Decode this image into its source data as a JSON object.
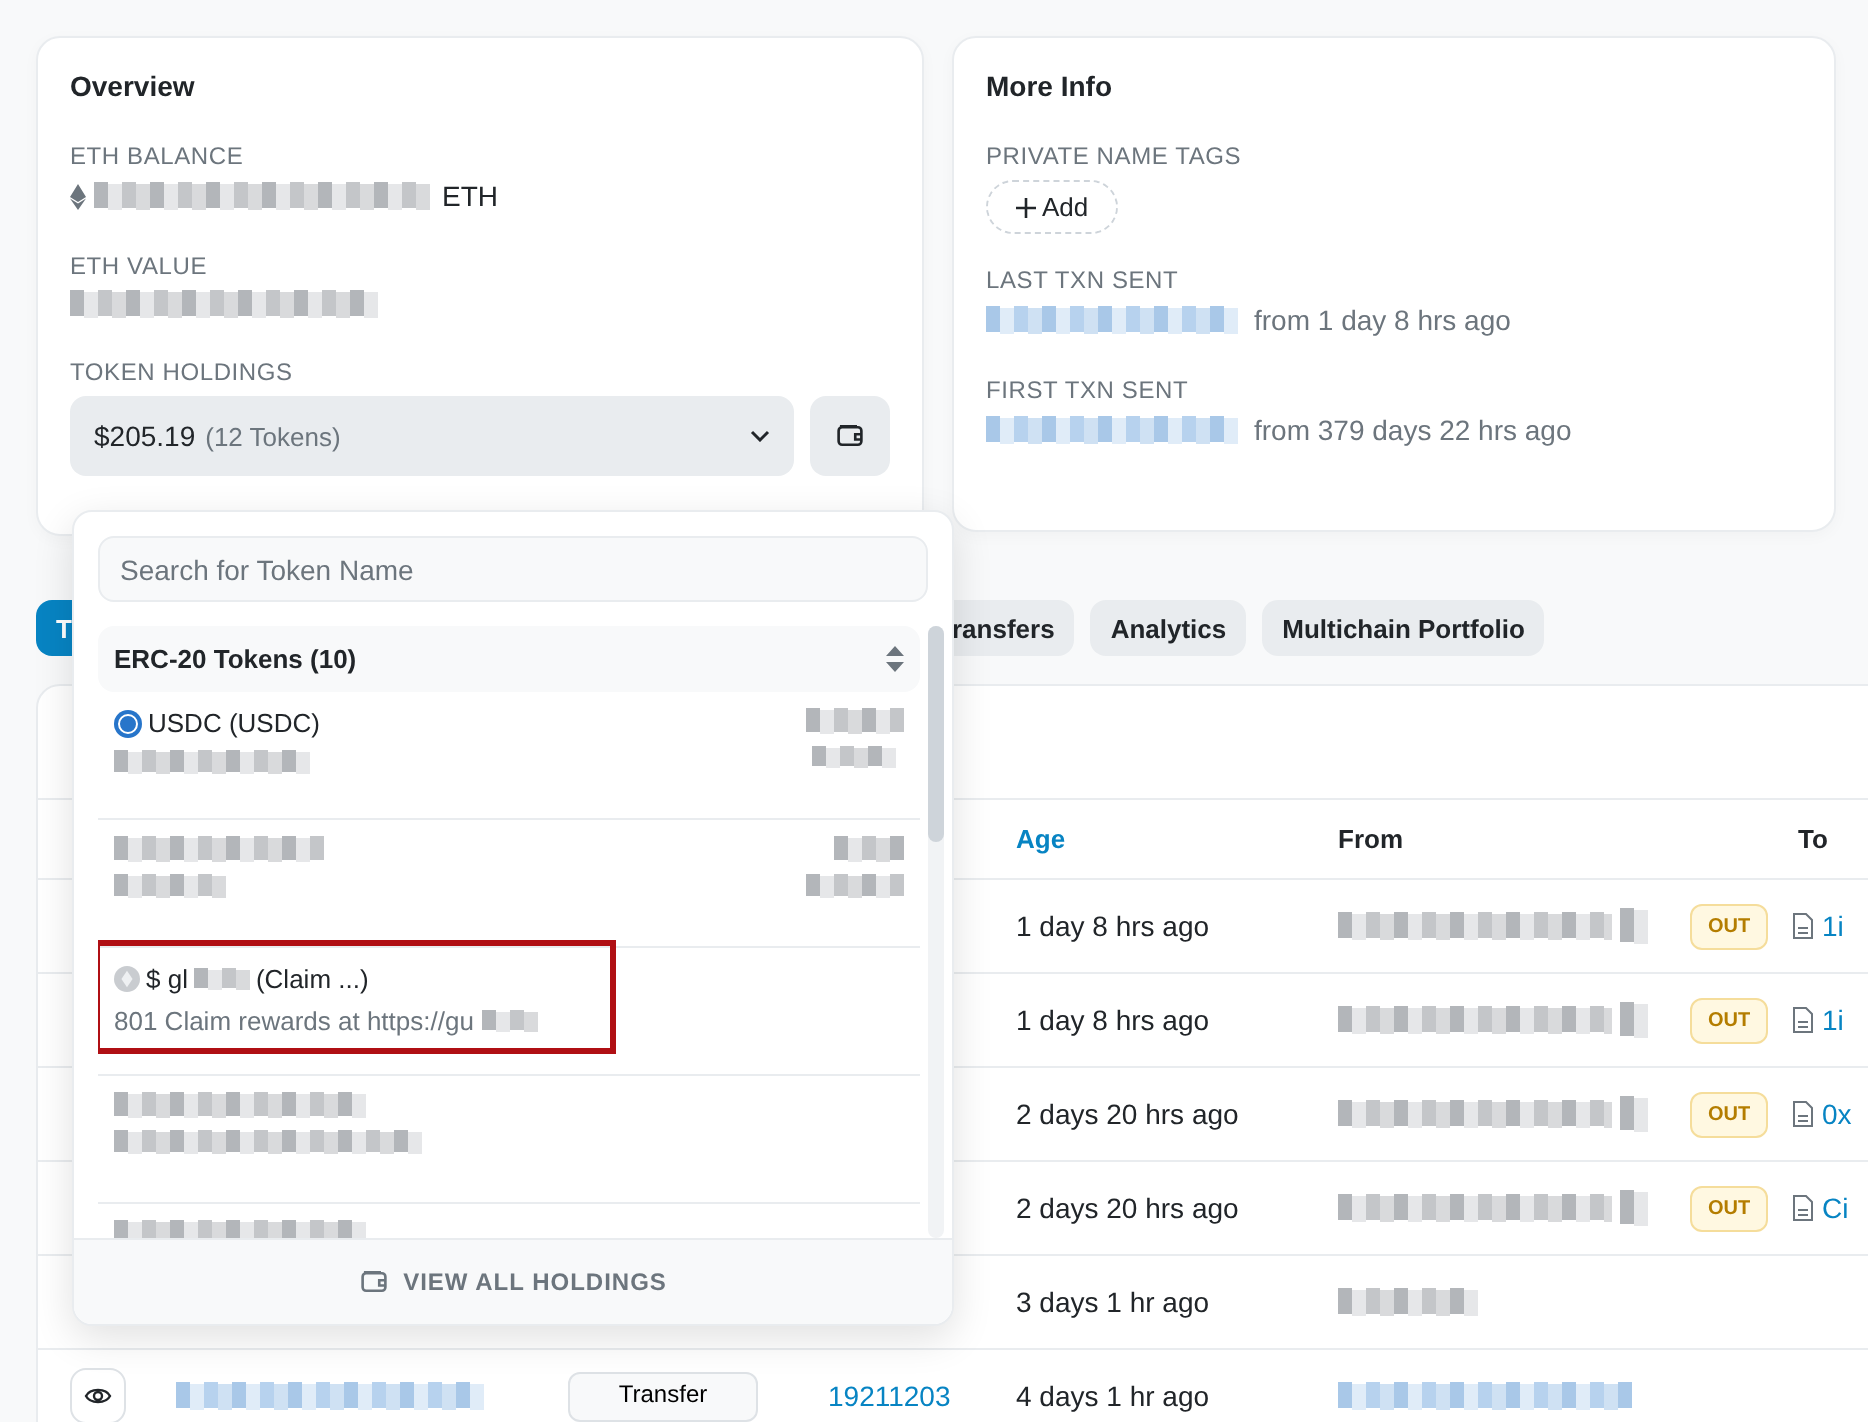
{
  "overview": {
    "title": "Overview",
    "eth_balance": {
      "label": "ETH BALANCE",
      "unit": "ETH"
    },
    "eth_value": {
      "label": "ETH VALUE"
    },
    "token_holdings": {
      "label": "TOKEN HOLDINGS",
      "value": "$205.19",
      "count": "(12 Tokens)",
      "expanded": true
    }
  },
  "more_info": {
    "title": "More Info",
    "private_name_tags": {
      "label": "PRIVATE NAME TAGS",
      "button": "Add"
    },
    "last_txn_sent": {
      "label": "LAST TXN SENT",
      "text": "from 1 day 8 hrs ago"
    },
    "first_txn_sent": {
      "label": "FIRST TXN SENT",
      "text": "from 379 days 22 hrs ago"
    }
  },
  "tabs": [
    {
      "label": "T",
      "selected": true
    },
    {
      "label": "ransfers",
      "selected": false
    },
    {
      "label": "Analytics",
      "selected": false
    },
    {
      "label": "Multichain Portfolio",
      "selected": false
    }
  ],
  "table": {
    "columns": [
      {
        "label": "Age",
        "sorted": true
      },
      {
        "label": "From",
        "sorted": false
      },
      {
        "label": "To",
        "sorted": false
      }
    ],
    "rows": [
      {
        "age": "1 day 8 hrs ago",
        "direction": "OUT",
        "to": "1i"
      },
      {
        "age": "1 day 8 hrs ago",
        "direction": "OUT",
        "to": "1i"
      },
      {
        "age": "2 days 20 hrs ago",
        "direction": "OUT",
        "to": "0x"
      },
      {
        "age": "2 days 20 hrs ago",
        "direction": "OUT",
        "to": "Ci"
      },
      {
        "age": "3 days 1 hr ago"
      },
      {
        "age": "4 days 1 hr ago",
        "method": "Transfer",
        "block": "19211203"
      }
    ]
  },
  "token_dropdown": {
    "search": {
      "placeholder": "Search for Token Name"
    },
    "group": "ERC-20 Tokens (10)",
    "tokens": [
      {
        "kind": "named",
        "name": "USDC (USDC)"
      },
      {
        "kind": "hidden"
      },
      {
        "kind": "flagged",
        "name_start": "$ gl",
        "name_end": "(Claim ...)",
        "description": "801 Claim rewards at https://gu",
        "highlighted": true
      },
      {
        "kind": "hidden"
      },
      {
        "kind": "hidden"
      }
    ],
    "footer": "VIEW ALL HOLDINGS"
  }
}
